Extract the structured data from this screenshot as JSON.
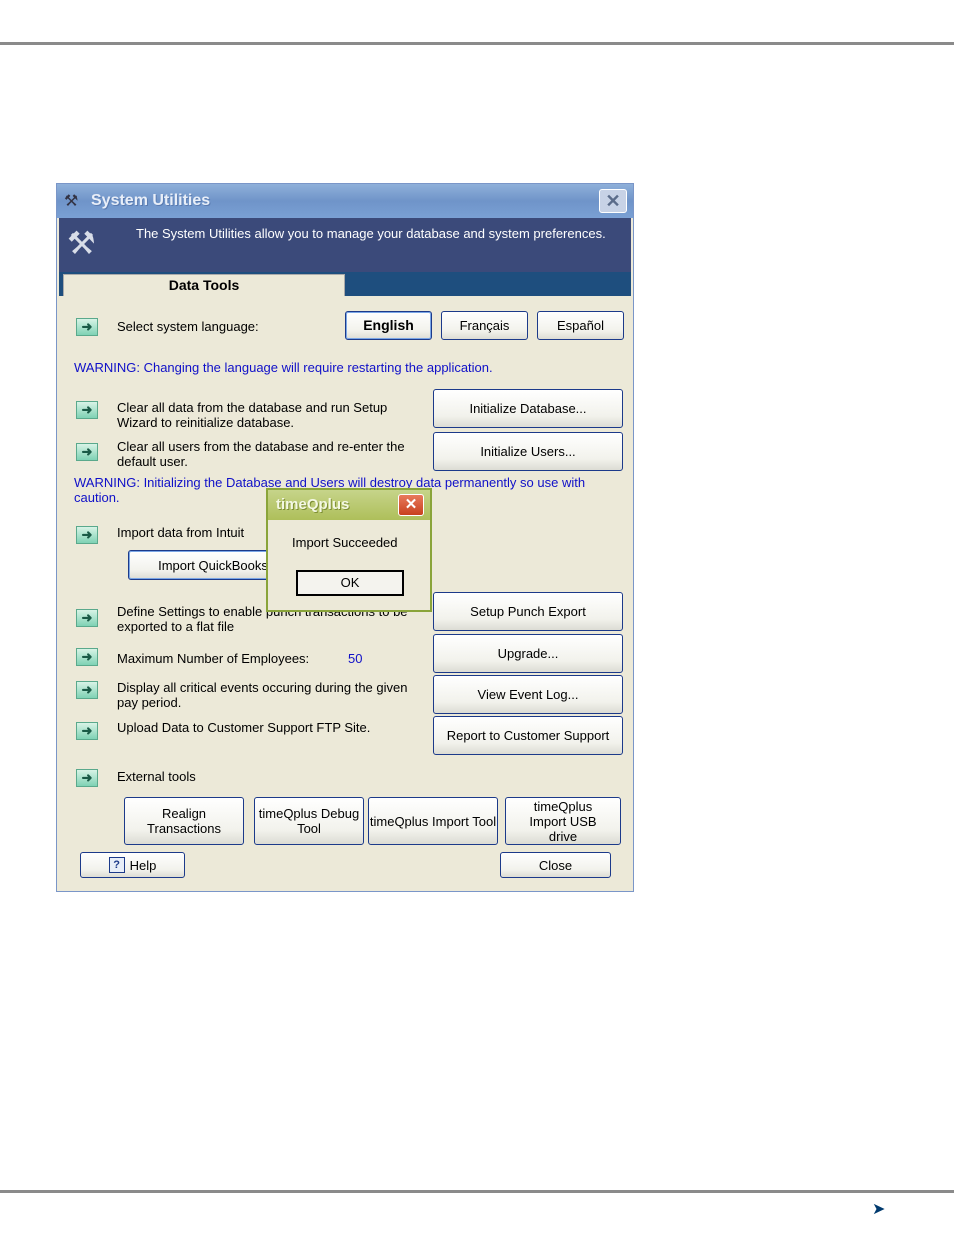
{
  "window": {
    "title": "System Utilities",
    "description": "The System Utilities allow you to manage your database and system preferences.",
    "close_glyph": "✕",
    "tab": "Data Tools"
  },
  "language": {
    "label": "Select system language:",
    "buttons": [
      "English",
      "Français",
      "Español"
    ],
    "warning": "WARNING:  Changing the language will require restarting the application."
  },
  "rows": {
    "init_db_text": "Clear all data from the database and run Setup Wizard to reinitialize database.",
    "init_db_button": "Initialize Database...",
    "init_users_text": "Clear all users from the  database and re-enter the default user.",
    "init_users_button": "Initialize Users...",
    "init_warning": "WARNING:  Initializing the Database and Users will destroy data permanently so use with caution.",
    "import_text": "Import data from Intuit",
    "import_button": "Import QuickBooks",
    "punch_text": "Define Settings to enable punch transactions to be exported to a flat file",
    "punch_button": "Setup Punch Export",
    "max_emp_text": "Maximum Number of Employees:",
    "max_emp_value": "50",
    "upgrade_button": "Upgrade...",
    "events_text": "Display all critical events occuring during the given pay period.",
    "events_button": "View Event Log...",
    "ftp_text": "Upload Data to Customer Support FTP Site.",
    "ftp_button": "Report to Customer Support",
    "external_text": "External tools"
  },
  "external_tools": [
    "Realign Transactions",
    "timeQplus Debug Tool",
    "timeQplus Import Tool",
    "timeQplus Import USB drive"
  ],
  "footer": {
    "help": "Help",
    "help_glyph": "?",
    "close": "Close"
  },
  "message_box": {
    "title": "timeQplus",
    "close_glyph": "✕",
    "message": "Import Succeeded",
    "ok": "OK"
  },
  "colors": {
    "warning_text": "#1010c8",
    "banner": "#3b4a7a",
    "tab_strip": "#1e4e7e",
    "dialog_bg": "#ece9d8"
  }
}
